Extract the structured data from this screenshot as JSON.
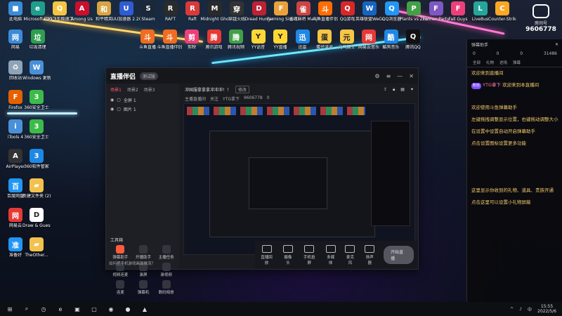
{
  "desktop_icons_top": [
    {
      "label": "此电脑",
      "color": "#3b8bd9",
      "glyph": "■"
    },
    {
      "label": "Microsoft Edge",
      "color": "#1f9e8d",
      "glyph": "e"
    },
    {
      "label": "QQ飞车极速工具",
      "color": "#f4c542",
      "glyph": "Q"
    },
    {
      "label": "Among Us",
      "color": "#c8102e",
      "glyph": "A"
    },
    {
      "label": "和平精英",
      "color": "#d9a441",
      "glyph": "和"
    },
    {
      "label": "UU加速器 2.20.1",
      "color": "#2f5bd3",
      "glyph": "U"
    },
    {
      "label": "Steam",
      "color": "#1b2838",
      "glyph": "S"
    },
    {
      "label": "RAFT",
      "color": "#2b2b2b",
      "glyph": "R"
    },
    {
      "label": "Raft",
      "color": "#d73a3a",
      "glyph": "R"
    },
    {
      "label": "Midnight Ghost Hunt",
      "color": "#2a2a2a",
      "glyph": "M"
    },
    {
      "label": "穿越火线",
      "color": "#333",
      "glyph": "穿"
    },
    {
      "label": "Dread Hunger",
      "color": "#b23",
      "glyph": "D"
    },
    {
      "label": "Farming Simulator",
      "color": "#e9a23b",
      "glyph": "F"
    },
    {
      "label": "雀魂麻将 Mahjong",
      "color": "#c44",
      "glyph": "雀"
    },
    {
      "label": "斗鱼直播伴侣",
      "color": "#ff6d00",
      "glyph": "斗"
    },
    {
      "label": "QQ游戏",
      "color": "#d62828",
      "glyph": "Q"
    },
    {
      "label": "英雄联盟WeGame",
      "color": "#1565c0",
      "glyph": "W"
    },
    {
      "label": "QQ浏览器",
      "color": "#2196f3",
      "glyph": "Q"
    },
    {
      "label": "Plants vs Zombies",
      "color": "#43a047",
      "glyph": "P"
    },
    {
      "label": "Funner Party",
      "color": "#7e57c2",
      "glyph": "F"
    },
    {
      "label": "Fall Guys",
      "color": "#ec407a",
      "glyph": "F"
    },
    {
      "label": "LiveBus",
      "color": "#26a69a",
      "glyph": "L"
    },
    {
      "label": "Counter-Strike: Global Off",
      "color": "#f9a825",
      "glyph": "C"
    }
  ],
  "desktop_icons_row2": [
    {
      "label": "网易",
      "color": "#3b8bd9",
      "glyph": "网"
    },
    {
      "label": "垃圾清理",
      "color": "#2e9e4f",
      "glyph": "垃"
    },
    {
      "label": "斗鱼直播",
      "color": "#f06c20",
      "glyph": "斗"
    },
    {
      "label": "斗鱼直播伴侣",
      "color": "#f06c20",
      "glyph": "斗"
    },
    {
      "label": "剪映",
      "color": "#ec407a",
      "glyph": "剪"
    },
    {
      "label": "腾讯游戏",
      "color": "#e53935",
      "glyph": "腾"
    },
    {
      "label": "腾讯视频",
      "color": "#43a047",
      "glyph": "腾"
    },
    {
      "label": "YY语音",
      "color": "#fdd835",
      "glyph": "Y"
    },
    {
      "label": "YY直播",
      "color": "#fdd835",
      "glyph": "Y"
    },
    {
      "label": "迅雷",
      "color": "#1e88e5",
      "glyph": "迅"
    },
    {
      "label": "蛋仔派对",
      "color": "#f6c644",
      "glyph": "蛋"
    },
    {
      "label": "元气骑士",
      "color": "#f6c644",
      "glyph": "元"
    },
    {
      "label": "网易云音乐",
      "color": "#e53935",
      "glyph": "网"
    },
    {
      "label": "酷狗音乐",
      "color": "#1e88e5",
      "glyph": "酷"
    },
    {
      "label": "腾讯QQ",
      "color": "#111",
      "glyph": "Q"
    }
  ],
  "desktop_icons_left": [
    {
      "label": "回收站",
      "color": "#8fa3b8",
      "glyph": "♻"
    },
    {
      "label": "Windows 更新",
      "color": "#4a90d9",
      "glyph": "W"
    },
    {
      "label": "Firefox",
      "color": "#e66000",
      "glyph": "F"
    },
    {
      "label": "360安全卫士",
      "color": "#3dbb4a",
      "glyph": "3"
    },
    {
      "label": "iTools 4",
      "color": "#4a90d9",
      "glyph": "i"
    },
    {
      "label": "360安全卫士",
      "color": "#3dbb4a",
      "glyph": "3"
    },
    {
      "label": "AirPlayer",
      "color": "#333",
      "glyph": "A"
    },
    {
      "label": "360软件管家",
      "color": "#1e88e5",
      "glyph": "3"
    },
    {
      "label": "百度网盘",
      "color": "#2196f3",
      "glyph": "百"
    },
    {
      "label": "新建文件夹 (2)",
      "color": "#f2c14e",
      "glyph": "▰"
    },
    {
      "label": "网易云",
      "color": "#e53935",
      "glyph": "网"
    },
    {
      "label": "Draw & Guess",
      "color": "#ffffff",
      "glyph": "D"
    },
    {
      "label": "准备好",
      "color": "#2196f3",
      "glyph": "准"
    },
    {
      "label": "TheOther...",
      "color": "#f2c14e",
      "glyph": "▰"
    }
  ],
  "live_window": {
    "title": "直播伴侣",
    "version": "测试版",
    "scene_tabs": [
      "场景1",
      "场景2",
      "场景3"
    ],
    "sources": [
      "全屏 1",
      "图片 1"
    ],
    "room_title": "冲国服拿拿拿冲冲冲！！",
    "room_button": "修改",
    "room_meta": [
      "主播直播间",
      "关注",
      "YTG拿下",
      "9606778",
      "0"
    ],
    "toolbox_title": "工具箱",
    "tools": [
      "弹幕助手",
      "开播助手",
      "主播任务",
      "视频连麦",
      "录屏",
      "录视频",
      "连麦",
      "弹幕机",
      "数码相册"
    ],
    "bottom_buttons": [
      "直播回放",
      "摄像头",
      "手机投屏",
      "多媒体",
      "麦克风",
      "扬声器"
    ],
    "start_live": "开始直播",
    "notice": "如何把手机游戏画面推流？"
  },
  "chat": {
    "header": "弹幕助手",
    "stats": [
      "0",
      "0",
      "0",
      "31486"
    ],
    "tabs": [
      "全部",
      "礼物",
      "进场",
      "弹幕"
    ],
    "messages": [
      {
        "text": "欢迎来到直播间",
        "white": false
      },
      {
        "tag": "粉丝",
        "user": "YTG拿下",
        "text": "欢迎来到本直播间",
        "white": false
      },
      {
        "text": "欢迎使用斗鱼弹幕助手",
        "white": false
      },
      {
        "text": "左键拖拽调整显示位置，右键拖动调整大小",
        "white": false
      },
      {
        "text": "在设置中设置自动开启弹幕助手",
        "white": false
      },
      {
        "text": "点击设置图标设置更多功能",
        "white": false
      },
      {
        "text": "这里显示你收到的礼物、道具、贵族开通",
        "white": false
      },
      {
        "text": "点击这里可以设置小礼物屏蔽",
        "white": false
      }
    ]
  },
  "room_badge": {
    "label": "房间号",
    "number": "9606778"
  },
  "taskbar": {
    "items": [
      "⊞",
      "⌕",
      "◷",
      "e",
      "▣",
      "▢",
      "◉",
      "●",
      "▲"
    ],
    "time": "15:55",
    "date": "2022/5/6",
    "tray": [
      "^",
      "♪",
      "中"
    ]
  }
}
